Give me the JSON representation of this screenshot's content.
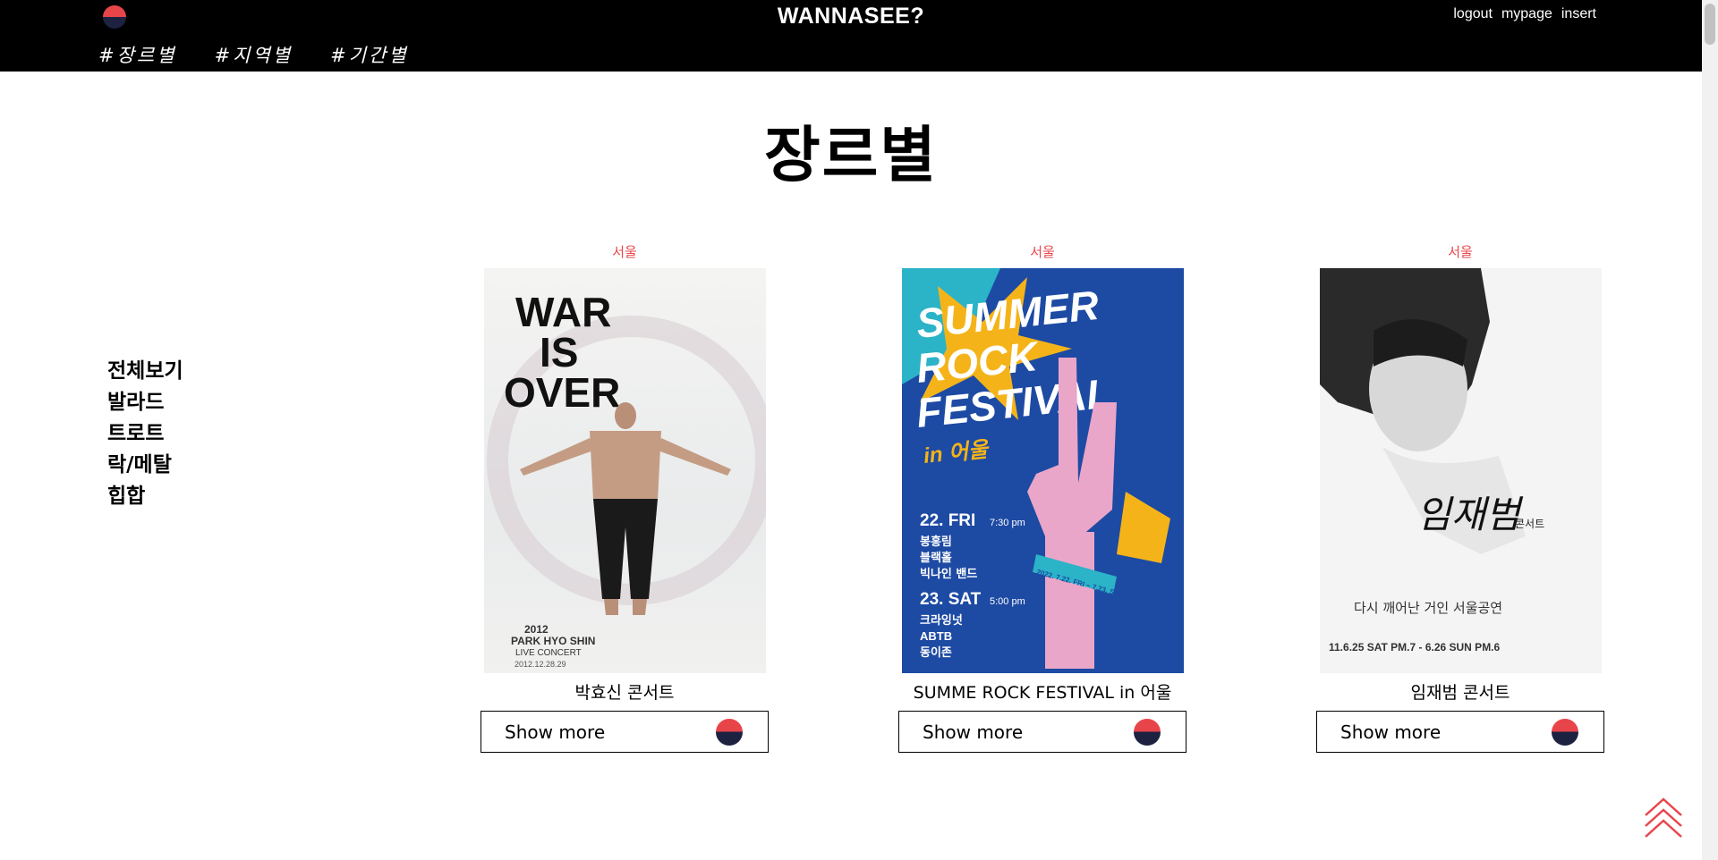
{
  "header": {
    "title": "WANNASEE?",
    "links": [
      "logout",
      "mypage",
      "insert"
    ],
    "nav": [
      "#장르별",
      "#지역별",
      "#기간별"
    ]
  },
  "page": {
    "title": "장르별"
  },
  "sidebar": {
    "items": [
      "전체보기",
      "발라드",
      "트로트",
      "락/메탈",
      "힙합"
    ]
  },
  "cards": [
    {
      "region": "서울",
      "name": "박효신 콘서트",
      "button": "Show more",
      "poster_text": {
        "line1": "WAR",
        "line2": "IS",
        "line3": "OVER",
        "sub1": "2012",
        "sub2": "PARK HYO SHIN",
        "sub3": "LIVE CONCERT",
        "sub4": "2012.12.28.29"
      }
    },
    {
      "region": "서울",
      "name": "SUMME ROCK FESTIVAL in 어울",
      "button": "Show more",
      "poster_text": {
        "line1": "SUMMER",
        "line2": "ROCK",
        "line3": "FESTIVAL",
        "line4": "in 어울",
        "day1": "22. FRI",
        "time1": "7:30 pm",
        "day2": "23. SAT",
        "time2": "5:00 pm",
        "band1": "봉홍림",
        "band2": "블랙홀",
        "band3": "빅나인 밴드",
        "band4": "크라잉넛",
        "band5": "ABTB",
        "band6": "동이존",
        "dates": "2022. 7.22. FRI ~ 7.23. SAT"
      }
    },
    {
      "region": "서울",
      "name": "임재범 콘서트",
      "button": "Show more",
      "poster_text": {
        "title": "임재범",
        "subtitle": "콘서트",
        "line": "다시 깨어난 거인 서울공연",
        "dates": "11.6.25 SAT PM.7 - 6.26 SUN PM.6"
      }
    }
  ],
  "colors": {
    "accent": "#e8454b",
    "navy": "#1c2240",
    "header_bg": "#000000"
  }
}
